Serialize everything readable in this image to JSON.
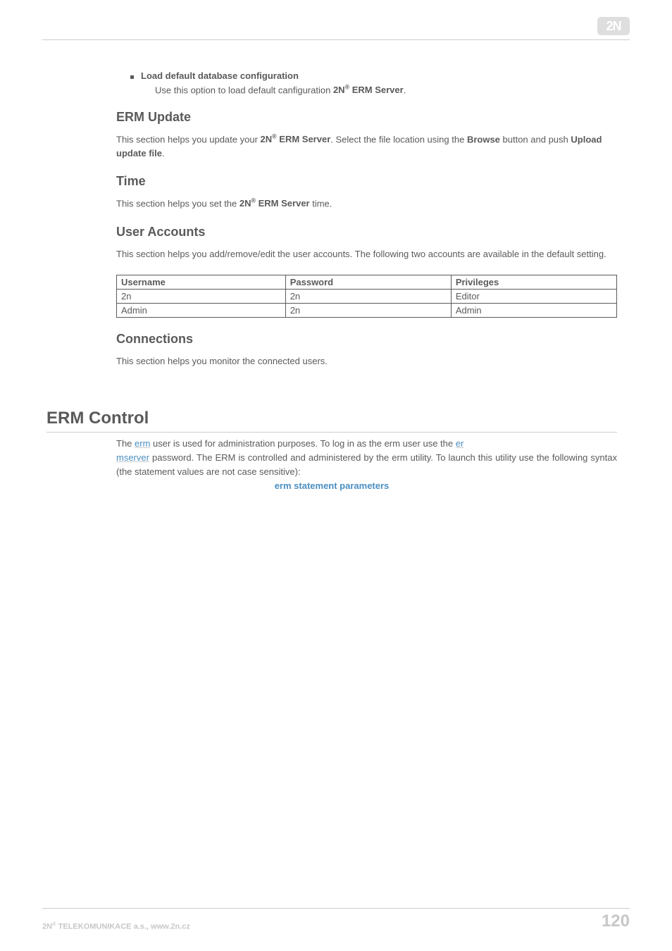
{
  "header": {
    "logo_text": "2N"
  },
  "bullet": {
    "title": "Load default database configuration",
    "sub_prefix": "Use this option to load default canfiguration ",
    "sub_bold": "2N",
    "sub_bold2": " ERM Server",
    "sub_suffix": "."
  },
  "erm_update": {
    "heading": "ERM Update",
    "p1_a": "This section helps you update your ",
    "p1_b": "2N",
    "p1_c": " ERM Server",
    "p1_d": ". Select the file location using the ",
    "p1_e": "Browse",
    "p1_f": " button and push ",
    "p1_g": "Upload update file",
    "p1_h": "."
  },
  "time": {
    "heading": "Time",
    "p1_a": "This section helps you set the ",
    "p1_b": "2N",
    "p1_c": " ERM Server",
    "p1_d": " time."
  },
  "user_accounts": {
    "heading": "User Accounts",
    "intro": "This section helps you add/remove/edit the user accounts. The following two accounts are available in the default setting.",
    "table": {
      "headers": [
        "Username",
        "Password",
        "Privileges"
      ],
      "rows": [
        [
          "2n",
          "2n",
          "Editor"
        ],
        [
          "Admin",
          "2n",
          "Admin"
        ]
      ]
    }
  },
  "connections": {
    "heading": "Connections",
    "text": "This section helps you monitor the connected users."
  },
  "erm_control": {
    "heading": "ERM Control",
    "p_a": "The ",
    "p_link1": "erm",
    "p_b": " user is used for administration purposes. To log in as the erm user use the ",
    "p_link2a": "er",
    "p_link2b": "mserver",
    "p_c": " password. The ERM is controlled and administered by the erm utility. To launch this utility use the following syntax (the statement values are not case sensitive):",
    "command": "erm  statement  parameters"
  },
  "footer": {
    "left_a": "2N",
    "left_b": " TELEKOMUNIKACE a.s., www.2n.cz",
    "page": "120"
  }
}
